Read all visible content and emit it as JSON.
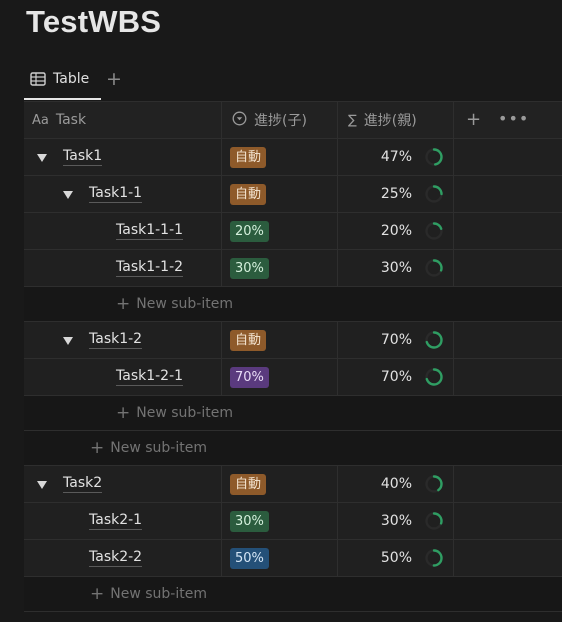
{
  "page": {
    "title": "TestWBS"
  },
  "view": {
    "tab_label": "Table",
    "add_label": "+"
  },
  "columns": {
    "task": {
      "prefix": "Aa",
      "label": "Task"
    },
    "progress_child": {
      "icon": "select-circle-icon",
      "label": "進捗(子)"
    },
    "progress_parent": {
      "icon": "sigma-icon",
      "label": "進捗(親)"
    },
    "add": "+",
    "more": "•••"
  },
  "new_sub_item_label": "New sub-item",
  "rows": [
    {
      "type": "item",
      "task": "Task1",
      "level": 0,
      "toggle": true,
      "child": "自動",
      "child_color": "auto",
      "parent": "47%",
      "progress": 0.47
    },
    {
      "type": "item",
      "task": "Task1-1",
      "level": 1,
      "toggle": true,
      "child": "自動",
      "child_color": "auto",
      "parent": "25%",
      "progress": 0.25
    },
    {
      "type": "item",
      "task": "Task1-1-1",
      "level": 2,
      "toggle": false,
      "child": "20%",
      "child_color": "green",
      "parent": "20%",
      "progress": 0.2
    },
    {
      "type": "item",
      "task": "Task1-1-2",
      "level": 2,
      "toggle": false,
      "child": "30%",
      "child_color": "green",
      "parent": "30%",
      "progress": 0.3
    },
    {
      "type": "newsub",
      "level": 2
    },
    {
      "type": "item",
      "task": "Task1-2",
      "level": 1,
      "toggle": true,
      "child": "自動",
      "child_color": "auto",
      "parent": "70%",
      "progress": 0.7
    },
    {
      "type": "item",
      "task": "Task1-2-1",
      "level": 2,
      "toggle": false,
      "child": "70%",
      "child_color": "purple",
      "parent": "70%",
      "progress": 0.7
    },
    {
      "type": "newsub",
      "level": 2
    },
    {
      "type": "newsub",
      "level": 1
    },
    {
      "type": "item",
      "task": "Task2",
      "level": 0,
      "toggle": true,
      "child": "自動",
      "child_color": "auto",
      "parent": "40%",
      "progress": 0.4
    },
    {
      "type": "item",
      "task": "Task2-1",
      "level": 1,
      "toggle": false,
      "child": "30%",
      "child_color": "green",
      "parent": "30%",
      "progress": 0.3
    },
    {
      "type": "item",
      "task": "Task2-2",
      "level": 1,
      "toggle": false,
      "child": "50%",
      "child_color": "blue",
      "parent": "50%",
      "progress": 0.5
    },
    {
      "type": "newsub",
      "level": 1
    }
  ],
  "colors": {
    "ring": "#2f9e63",
    "ring_track": "#2a2a2a"
  }
}
